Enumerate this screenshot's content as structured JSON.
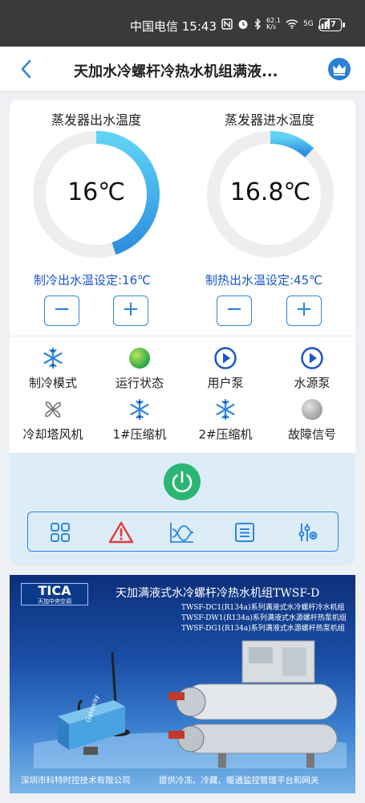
{
  "status_bar": {
    "carrier_time": "中国电信 15:43",
    "net_speed": "62.1 K/s",
    "signal": "5G",
    "battery": "87"
  },
  "header": {
    "title": "天加水冷螺杆冷热水机组满液..."
  },
  "gauges": [
    {
      "title": "蒸发器出水温度",
      "value": "16℃",
      "fill": 0.45
    },
    {
      "title": "蒸发器进水温度",
      "value": "16.8℃",
      "fill": 0.12
    }
  ],
  "setpoints": {
    "cooling": "制冷出水温设定:16℃",
    "heating": "制热出水温设定:45℃",
    "minus": "−",
    "plus": "+"
  },
  "status_items": [
    {
      "label": "制冷模式",
      "icon": "snowflake-icon"
    },
    {
      "label": "运行状态",
      "icon": "green-dot-icon"
    },
    {
      "label": "用户泵",
      "icon": "play-circle-icon"
    },
    {
      "label": "水源泵",
      "icon": "play-circle-icon"
    },
    {
      "label": "冷却塔风机",
      "icon": "fan-icon"
    },
    {
      "label": "1#压缩机",
      "icon": "snowflake-icon"
    },
    {
      "label": "2#压缩机",
      "icon": "snowflake-icon"
    },
    {
      "label": "故障信号",
      "icon": "gray-dot-icon"
    }
  ],
  "colors": {
    "accent": "#2e86de",
    "setpoint_text": "#1a56c8",
    "power": "#2bb673",
    "alarm": "#e53935",
    "bottom_bg": "#dcedf8"
  },
  "banner": {
    "logo": "TICA",
    "logo_sub": "天加中央空调",
    "title": "天加满液式水冷螺杆冷热水机组TWSF-D",
    "lines": [
      "TWSF-DC1(R134a)系列满液式水冷螺杆冷水机组",
      "TWSF-DW1(R134a)系列满液式水源螺杆热泵机组",
      "TWSF-DG1(R134a)系列满液式水源螺杆热泵机组"
    ],
    "footer_left": "深圳市科特时控技术有限公司",
    "footer_right": "提供冷冻、冷藏、暖通监控管理平台和网关",
    "device_label": "Gateway"
  }
}
